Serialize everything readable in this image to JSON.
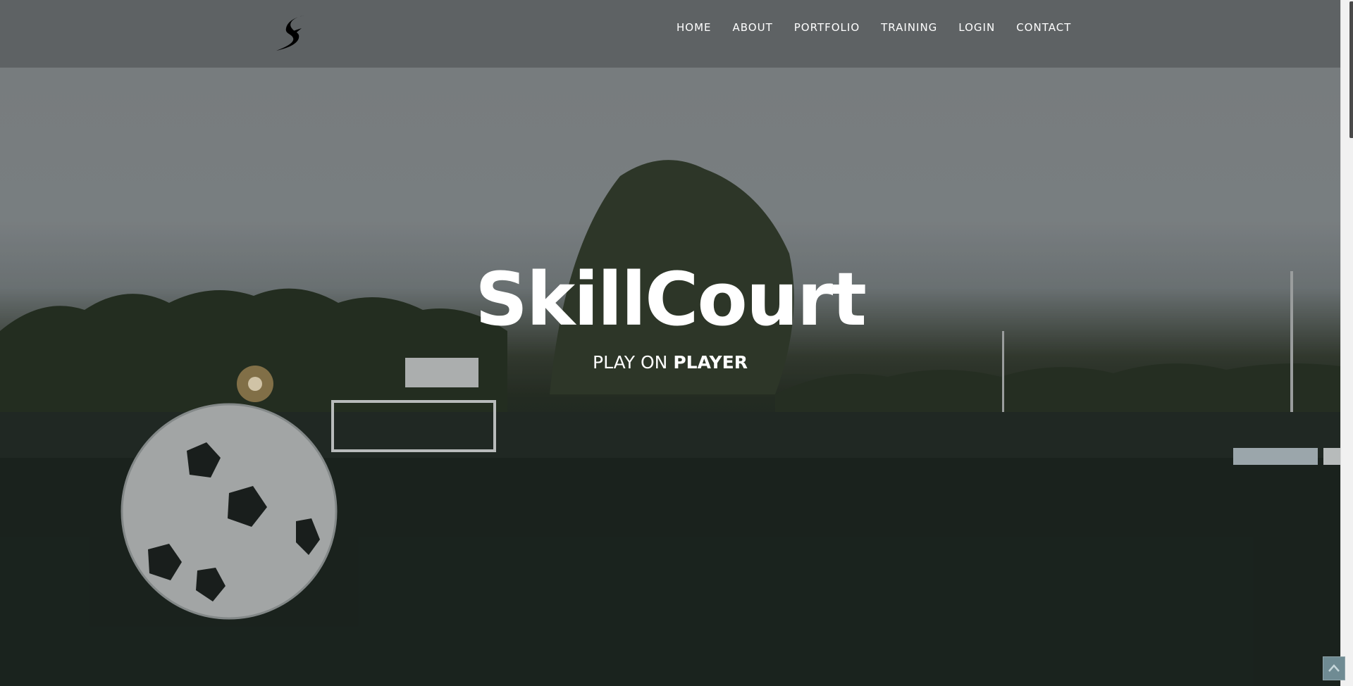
{
  "header": {
    "logo_icon": "swoosh-s-logo-icon",
    "nav": [
      "HOME",
      "ABOUT",
      "PORTFOLIO",
      "TRAINING",
      "LOGIN",
      "CONTACT"
    ]
  },
  "hero": {
    "title": "SkillCourt",
    "subtitle_light": "PLAY ON ",
    "subtitle_bold": "PLAYER"
  },
  "back_to_top": {
    "icon": "chevron-up-icon"
  }
}
